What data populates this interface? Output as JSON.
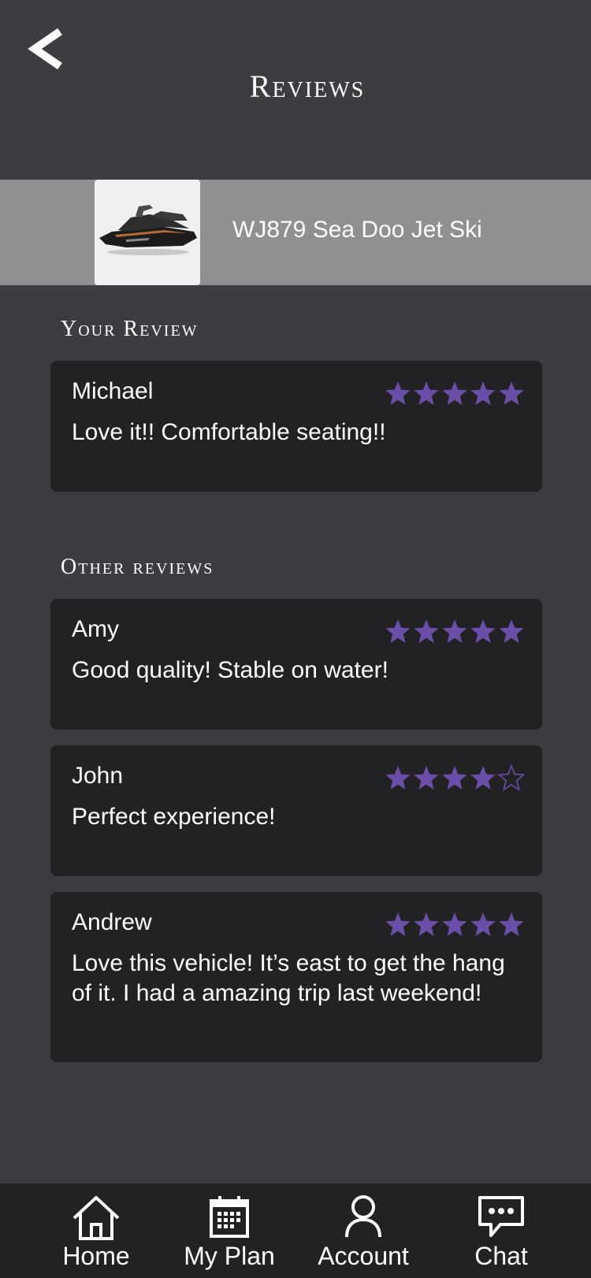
{
  "header": {
    "title": "Reviews"
  },
  "product": {
    "name": "WJ879 Sea Doo Jet Ski",
    "image": "jet-ski-thumbnail"
  },
  "your_review": {
    "section_title": "Your Review",
    "review": {
      "name": "Michael",
      "text": "Love it!! Comfortable seating!!",
      "rating": 5,
      "max_rating": 5
    }
  },
  "other_reviews": {
    "section_title": "Other reviews",
    "items": [
      {
        "name": "Amy",
        "text": "Good quality! Stable on water!",
        "rating": 5,
        "max_rating": 5
      },
      {
        "name": "John",
        "text": "Perfect experience!",
        "rating": 4,
        "max_rating": 5
      },
      {
        "name": "Andrew",
        "text": "Love this vehicle! It’s east to get the hang of it. I had a amazing trip last weekend!",
        "rating": 5,
        "max_rating": 5
      }
    ]
  },
  "tab_bar": {
    "items": [
      {
        "label": "Home",
        "icon": "home-icon"
      },
      {
        "label": "My Plan",
        "icon": "calendar-icon"
      },
      {
        "label": "Account",
        "icon": "person-icon"
      },
      {
        "label": "Chat",
        "icon": "chat-bubble-icon"
      }
    ]
  },
  "colors": {
    "background": "#3c3d40",
    "card": "#222224",
    "star": "#6b4ea8",
    "product_bar": "#909090",
    "tab_bar": "#222224"
  }
}
